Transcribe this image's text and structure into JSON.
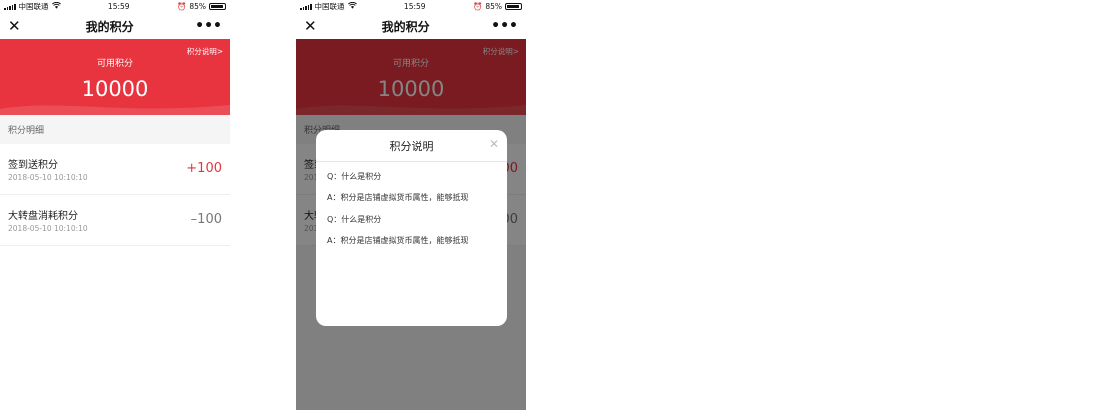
{
  "status_bar": {
    "carrier": "中国联通",
    "time": "15:59",
    "battery": "85%"
  },
  "navbar": {
    "title": "我的积分",
    "close_icon": "close-icon",
    "more_icon": "more-icon",
    "close_glyph": "✕",
    "more_glyph": "•••"
  },
  "points": {
    "label": "可用积分",
    "value": "10000",
    "explain_link": "积分说明>"
  },
  "details": {
    "section_title": "积分明细",
    "items": [
      {
        "name": "签到送积分",
        "time": "2018-05-10 10:10:10",
        "amount": "+100"
      },
      {
        "name": "大转盘消耗积分",
        "time": "2018-05-10 10:10:10",
        "amount": "–100"
      }
    ]
  },
  "modal": {
    "title": "积分说明",
    "close_glyph": "✕",
    "qa": [
      {
        "q": "Q：什么是积分",
        "a": "A：积分是店铺虚拟货币属性，能够抵现"
      },
      {
        "q": "Q：什么是积分",
        "a": "A：积分是店铺虚拟货币属性，能够抵现"
      }
    ]
  },
  "colors": {
    "accent": "#e8343f",
    "overlay": "rgba(0,0,0,0.48)"
  }
}
